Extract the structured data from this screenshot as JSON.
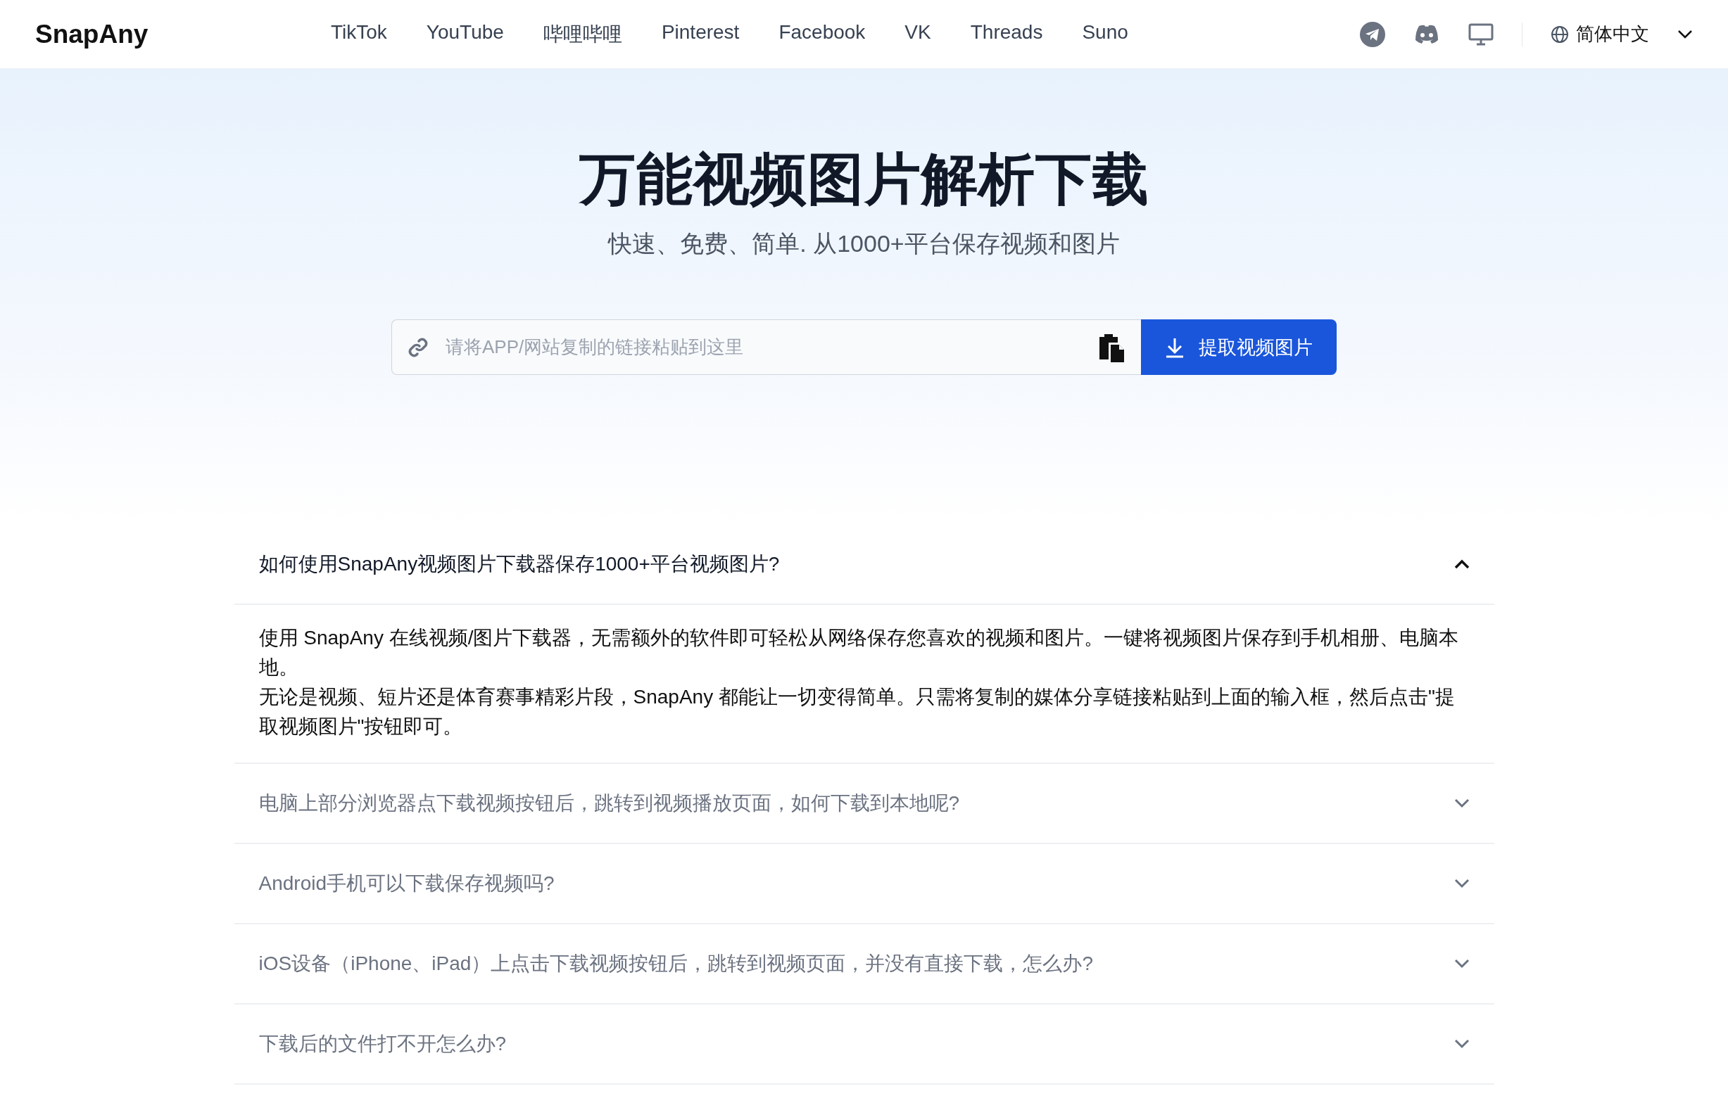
{
  "header": {
    "logo": "SnapAny",
    "nav": [
      "TikTok",
      "YouTube",
      "哔哩哔哩",
      "Pinterest",
      "Facebook",
      "VK",
      "Threads",
      "Suno"
    ],
    "language": "简体中文"
  },
  "hero": {
    "title": "万能视频图片解析下载",
    "subtitle": "快速、免费、简单. 从1000+平台保存视频和图片",
    "search": {
      "placeholder": "请将APP/网站复制的链接粘贴到这里",
      "button": "提取视频图片"
    }
  },
  "faq": [
    {
      "question": "如何使用SnapAny视频图片下载器保存1000+平台视频图片?",
      "expanded": true,
      "answer": [
        "使用 SnapAny 在线视频/图片下载器，无需额外的软件即可轻松从网络保存您喜欢的视频和图片。一键将视频图片保存到手机相册、电脑本地。",
        "无论是视频、短片还是体育赛事精彩片段，SnapAny 都能让一切变得简单。只需将复制的媒体分享链接粘贴到上面的输入框，然后点击\"提取视频图片\"按钮即可。"
      ]
    },
    {
      "question": "电脑上部分浏览器点下载视频按钮后，跳转到视频播放页面，如何下载到本地呢?",
      "expanded": false
    },
    {
      "question": "Android手机可以下载保存视频吗?",
      "expanded": false
    },
    {
      "question": "iOS设备（iPhone、iPad）上点击下载视频按钮后，跳转到视频页面，并没有直接下载，怎么办?",
      "expanded": false
    },
    {
      "question": "下载后的文件打不开怎么办?",
      "expanded": false
    }
  ]
}
